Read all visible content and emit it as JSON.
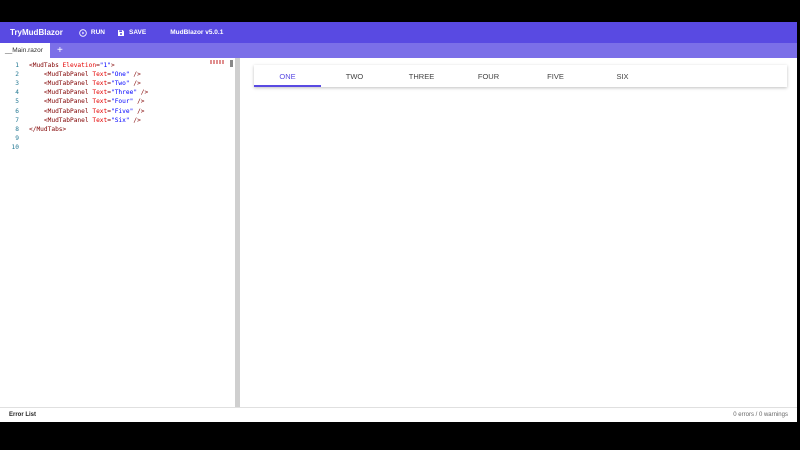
{
  "appbar": {
    "brand": "TryMudBlazor",
    "run_label": "RUN",
    "save_label": "SAVE",
    "version": "MudBlazor v5.0.1",
    "color": "#594ae2"
  },
  "file_tabs": {
    "active_file": "__Main.razor",
    "add_label": "+"
  },
  "editor": {
    "lines": [
      {
        "n": "1",
        "segs": [
          [
            "t",
            "<MudTabs "
          ],
          [
            "a",
            "Elevation"
          ],
          [
            "t",
            "="
          ],
          [
            "s",
            "\"1\""
          ],
          [
            "t",
            ">"
          ]
        ]
      },
      {
        "n": "2",
        "segs": [
          [
            "t",
            "    <MudTabPanel "
          ],
          [
            "a",
            "Text"
          ],
          [
            "t",
            "="
          ],
          [
            "s",
            "\"One\""
          ],
          [
            "t",
            " />"
          ]
        ]
      },
      {
        "n": "3",
        "segs": [
          [
            "t",
            "    <MudTabPanel "
          ],
          [
            "a",
            "Text"
          ],
          [
            "t",
            "="
          ],
          [
            "s",
            "\"Two\""
          ],
          [
            "t",
            " />"
          ]
        ]
      },
      {
        "n": "4",
        "segs": [
          [
            "t",
            "    <MudTabPanel "
          ],
          [
            "a",
            "Text"
          ],
          [
            "t",
            "="
          ],
          [
            "s",
            "\"Three\""
          ],
          [
            "t",
            " />"
          ]
        ]
      },
      {
        "n": "5",
        "segs": [
          [
            "t",
            "    <MudTabPanel "
          ],
          [
            "a",
            "Text"
          ],
          [
            "t",
            "="
          ],
          [
            "s",
            "\"Four\""
          ],
          [
            "t",
            " />"
          ]
        ]
      },
      {
        "n": "6",
        "segs": [
          [
            "t",
            "    <MudTabPanel "
          ],
          [
            "a",
            "Text"
          ],
          [
            "t",
            "="
          ],
          [
            "s",
            "\"Five\""
          ],
          [
            "t",
            " />"
          ]
        ]
      },
      {
        "n": "7",
        "segs": [
          [
            "t",
            "    <MudTabPanel "
          ],
          [
            "a",
            "Text"
          ],
          [
            "t",
            "="
          ],
          [
            "s",
            "\"Six\""
          ],
          [
            "t",
            " />"
          ]
        ]
      },
      {
        "n": "8",
        "segs": [
          [
            "t",
            "</MudTabs>"
          ]
        ]
      },
      {
        "n": "9",
        "segs": []
      },
      {
        "n": "10",
        "segs": []
      }
    ]
  },
  "preview": {
    "tabs": [
      "ONE",
      "TWO",
      "THREE",
      "FOUR",
      "FIVE",
      "SIX"
    ],
    "active_index": 0
  },
  "status": {
    "title": "Error List",
    "summary": "0 errors / 0 warnings"
  }
}
